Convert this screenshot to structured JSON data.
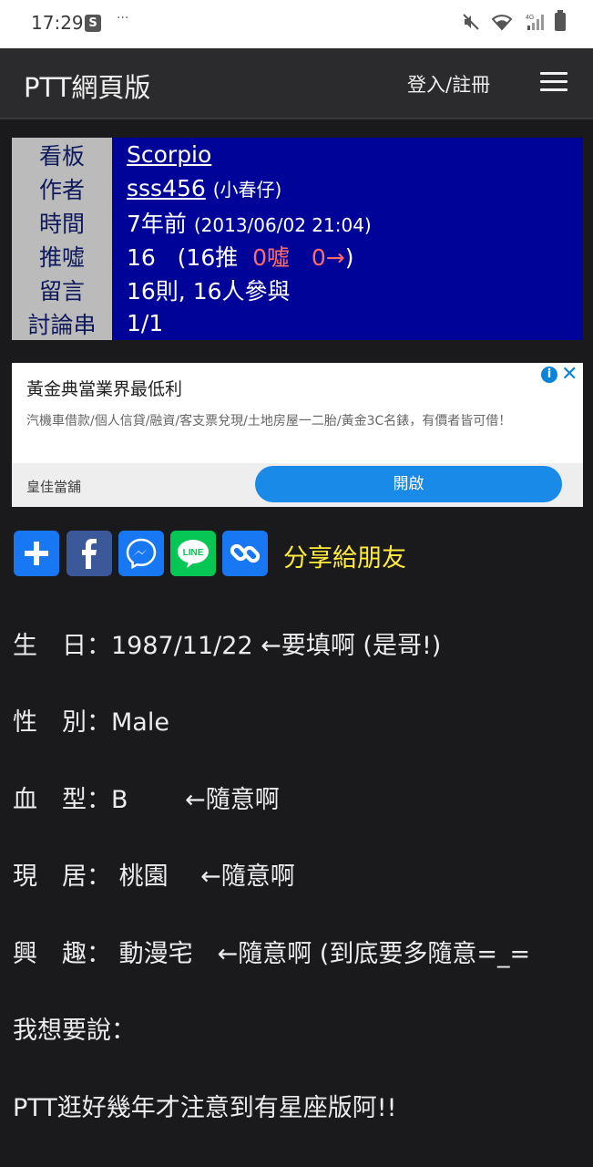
{
  "status": {
    "time": "17:29",
    "dots": "···",
    "shop_letter": "S",
    "net": "4G"
  },
  "nav": {
    "brand": "PTT網頁版",
    "login": "登入/註冊"
  },
  "meta": {
    "board_label": "看板",
    "board": "Scorpio",
    "author_label": "作者",
    "author": "sss456",
    "author_nick": "(小春仔)",
    "time_label": "時間",
    "time_rel": "7年前",
    "time_abs": "(2013/06/02 21:04)",
    "push_label": "推噓",
    "push_total": "16",
    "push_up": "(16推",
    "push_down": "0噓",
    "push_arrow": "0→)",
    "comments_label": "留言",
    "comments": "16則, 16人參與",
    "thread_label": "討論串",
    "thread": "1/1"
  },
  "ad": {
    "title": "黃金典當業界最低利",
    "desc": "汽機車借款/個人信貸/融資/客支票兌現/土地房屋一二胎/黃金3C名錶，有價者皆可借！",
    "advertiser": "皇佳當舖",
    "cta": "開啟"
  },
  "share": {
    "label": "分享給朋友"
  },
  "content": [
    "生　日：1987/11/22 ←要填啊 (是哥!)",
    "性　別：Male",
    "血　型：B　　 ←隨意啊",
    "現　居： 桃園　 ←隨意啊",
    "興　趣： 動漫宅　←隨意啊 (到底要多隨意=_=",
    "我想要說：",
    "PTT逛好幾年才注意到有星座版阿!!"
  ],
  "colors": {
    "bg": "#1a1a1d",
    "meta_bg": "#000397",
    "key_bg": "#bbbbbb",
    "share_label": "#ffeb3b",
    "red": "#ff6b6b"
  }
}
